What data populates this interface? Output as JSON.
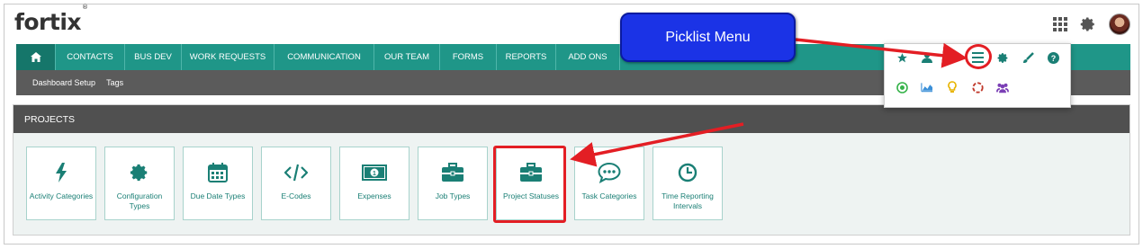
{
  "brand": {
    "name": "fortix",
    "mark": "®"
  },
  "top_icons": [
    "grid-icon",
    "gear-icon",
    "user-avatar"
  ],
  "nav": {
    "items": [
      {
        "label": "CONTACTS",
        "width": 1
      },
      {
        "label": "BUS DEV"
      },
      {
        "label": "WORK REQUESTS"
      },
      {
        "label": "COMMUNICATION"
      },
      {
        "label": "OUR TEAM"
      },
      {
        "label": "FORMS"
      },
      {
        "label": "REPORTS"
      },
      {
        "label": "ADD ONS"
      }
    ]
  },
  "subnav": {
    "items": [
      "Dashboard Setup",
      "Tags"
    ]
  },
  "panel": {
    "title": "PROJECTS"
  },
  "tiles": [
    {
      "label": "Activity Categories",
      "icon": "bolt-icon"
    },
    {
      "label": "Configuration Types",
      "icon": "cog-icon"
    },
    {
      "label": "Due Date Types",
      "icon": "calendar-icon"
    },
    {
      "label": "E-Codes",
      "icon": "code-icon"
    },
    {
      "label": "Expenses",
      "icon": "money-icon"
    },
    {
      "label": "Job Types",
      "icon": "briefcase-icon"
    },
    {
      "label": "Project Statuses",
      "icon": "briefcase-icon"
    },
    {
      "label": "Task Categories",
      "icon": "comment-icon"
    },
    {
      "label": "Time Reporting Intervals",
      "icon": "clock-icon"
    }
  ],
  "callout": {
    "text": "Picklist Menu"
  },
  "colors": {
    "teal": "#1f9688",
    "dark": "#505050",
    "red": "#e31e24",
    "callout_blue": "#1b33e6"
  }
}
